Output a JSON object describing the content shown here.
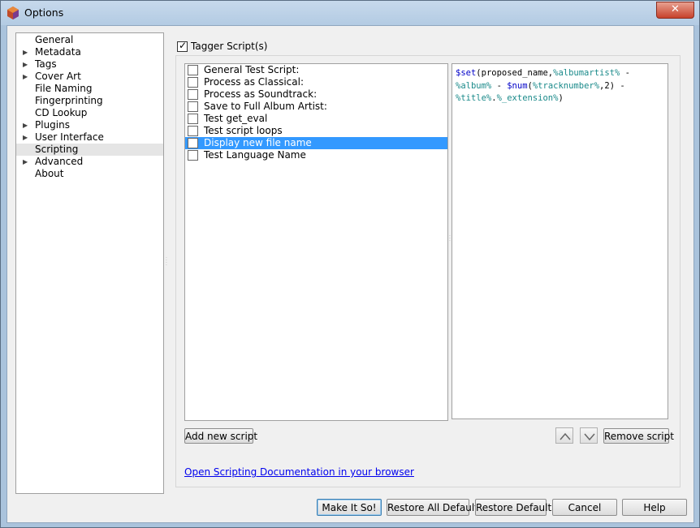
{
  "window": {
    "title": "Options",
    "close_label": "✕"
  },
  "nav": {
    "items": [
      {
        "label": "General",
        "expandable": false,
        "selected": false
      },
      {
        "label": "Metadata",
        "expandable": true,
        "selected": false
      },
      {
        "label": "Tags",
        "expandable": true,
        "selected": false
      },
      {
        "label": "Cover Art",
        "expandable": true,
        "selected": false
      },
      {
        "label": "File Naming",
        "expandable": false,
        "selected": false
      },
      {
        "label": "Fingerprinting",
        "expandable": false,
        "selected": false
      },
      {
        "label": "CD Lookup",
        "expandable": false,
        "selected": false
      },
      {
        "label": "Plugins",
        "expandable": true,
        "selected": false
      },
      {
        "label": "User Interface",
        "expandable": true,
        "selected": false
      },
      {
        "label": "Scripting",
        "expandable": false,
        "selected": true
      },
      {
        "label": "Advanced",
        "expandable": true,
        "selected": false
      },
      {
        "label": "About",
        "expandable": false,
        "selected": false
      }
    ]
  },
  "scripting": {
    "tagger_scripts_label": "Tagger Script(s)",
    "tagger_scripts_checked": true,
    "scripts": [
      {
        "label": "General Test Script:",
        "checked": false,
        "selected": false
      },
      {
        "label": "Process as Classical:",
        "checked": false,
        "selected": false
      },
      {
        "label": "Process as Soundtrack:",
        "checked": false,
        "selected": false
      },
      {
        "label": "Save to Full Album Artist:",
        "checked": false,
        "selected": false
      },
      {
        "label": "Test get_eval",
        "checked": false,
        "selected": false
      },
      {
        "label": "Test script loops",
        "checked": false,
        "selected": false
      },
      {
        "label": "Display new file name",
        "checked": false,
        "selected": true
      },
      {
        "label": "Test Language Name",
        "checked": false,
        "selected": false
      }
    ],
    "editor": {
      "line1": {
        "fn": "$set",
        "a": "(proposed_name,",
        "v1": "%albumartist%",
        "b": " -"
      },
      "line2": {
        "v1": "%album%",
        "a": " - ",
        "fn": "$num",
        "b": "(",
        "v2": "%tracknumber%",
        "c": ",2) -"
      },
      "line3": {
        "v1": "%title%",
        "a": ".",
        "v2": "%_extension%",
        "b": ")"
      }
    },
    "add_script_label": "Add new script",
    "remove_script_label": "Remove script",
    "doc_link_label": "Open Scripting Documentation in your browser"
  },
  "footer": {
    "make_it_so": "Make It So!",
    "restore_all_defaults": "Restore All Defaults",
    "restore_defaults": "Restore Defaults",
    "cancel": "Cancel",
    "help": "Help"
  },
  "colors": {
    "selection": "#3399ff",
    "link": "#0000ee",
    "script_function": "#0000c8",
    "script_variable": "#1a8a8a"
  }
}
